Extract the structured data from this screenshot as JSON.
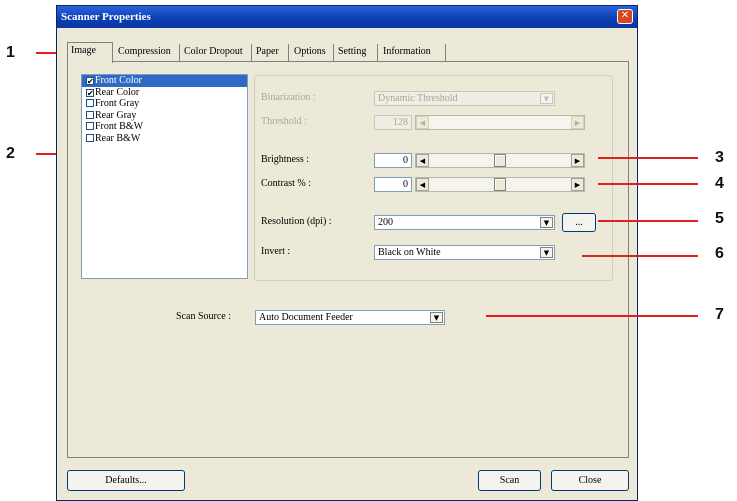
{
  "window": {
    "title": "Scanner Properties",
    "close_glyph": "✕"
  },
  "tabs": [
    {
      "label": "Image",
      "active": true
    },
    {
      "label": "Compression"
    },
    {
      "label": "Color Dropout"
    },
    {
      "label": "Paper"
    },
    {
      "label": "Options"
    },
    {
      "label": "Setting"
    },
    {
      "label": "Information"
    }
  ],
  "image_list": {
    "items": [
      {
        "label": "Front Color",
        "checked": true,
        "selected": true
      },
      {
        "label": "Rear Color",
        "checked": true
      },
      {
        "label": "Front Gray",
        "checked": false
      },
      {
        "label": "Rear Gray",
        "checked": false
      },
      {
        "label": "Front B&W",
        "checked": false
      },
      {
        "label": "Rear B&W",
        "checked": false
      }
    ]
  },
  "settings": {
    "binarization": {
      "label": "Binarization :",
      "value": "Dynamic Threshold",
      "enabled": false
    },
    "threshold": {
      "label": "Threshold :",
      "value": "128",
      "enabled": false
    },
    "brightness": {
      "label": "Brightness :",
      "value": "0",
      "slider_fraction": 0.5
    },
    "contrast": {
      "label": "Contrast % :",
      "value": "0",
      "slider_fraction": 0.5
    },
    "resolution": {
      "label": "Resolution (dpi) :",
      "value": "200",
      "more_button": "..."
    },
    "invert": {
      "label": "Invert :",
      "value": "Black on White"
    }
  },
  "scan_source": {
    "label": "Scan Source :",
    "value": "Auto Document Feeder"
  },
  "buttons": {
    "defaults": "Defaults...",
    "scan": "Scan",
    "close": "Close"
  },
  "icons": {
    "combo_arrow": "▼",
    "scroll_left": "◀",
    "scroll_right": "▶",
    "checkmark": "✔"
  },
  "callouts": [
    "1",
    "2",
    "3",
    "4",
    "5",
    "6",
    "7"
  ],
  "colors": {
    "accent_line": "#e02020",
    "title_bar": "#0b3fb3",
    "selection": "#316ac5"
  }
}
